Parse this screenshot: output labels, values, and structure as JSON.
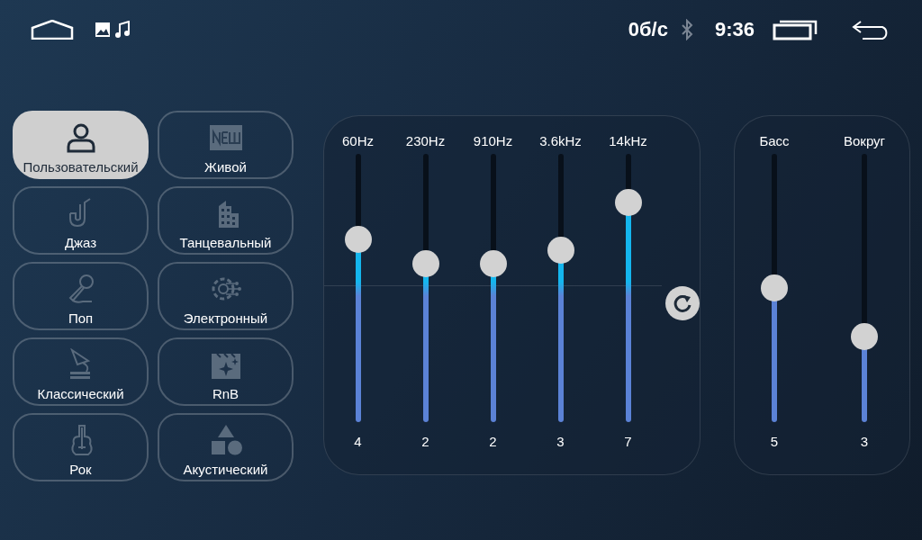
{
  "status_bar": {
    "data_rate": "0б/с",
    "bluetooth_connected": false,
    "time": "9:36"
  },
  "presets": [
    {
      "label": "Пользовательский",
      "selected": true
    },
    {
      "label": "Живой",
      "selected": false
    },
    {
      "label": "Джаз",
      "selected": false
    },
    {
      "label": "Танцевальный",
      "selected": false
    },
    {
      "label": "Поп",
      "selected": false
    },
    {
      "label": "Электронный",
      "selected": false
    },
    {
      "label": "Классический",
      "selected": false
    },
    {
      "label": "RnB",
      "selected": false
    },
    {
      "label": "Рок",
      "selected": false
    },
    {
      "label": "Акустический",
      "selected": false
    }
  ],
  "bands": [
    {
      "label": "60Hz",
      "level": 0.68,
      "value": "4"
    },
    {
      "label": "230Hz",
      "level": 0.59,
      "value": "2"
    },
    {
      "label": "910Hz",
      "level": 0.59,
      "value": "2"
    },
    {
      "label": "3.6kHz",
      "level": 0.64,
      "value": "3"
    },
    {
      "label": "14kHz",
      "level": 0.82,
      "value": "7"
    }
  ],
  "effects": [
    {
      "label": "Басс",
      "level": 0.5,
      "value": "5"
    },
    {
      "label": "Вокруг",
      "level": 0.32,
      "value": "3"
    }
  ]
}
